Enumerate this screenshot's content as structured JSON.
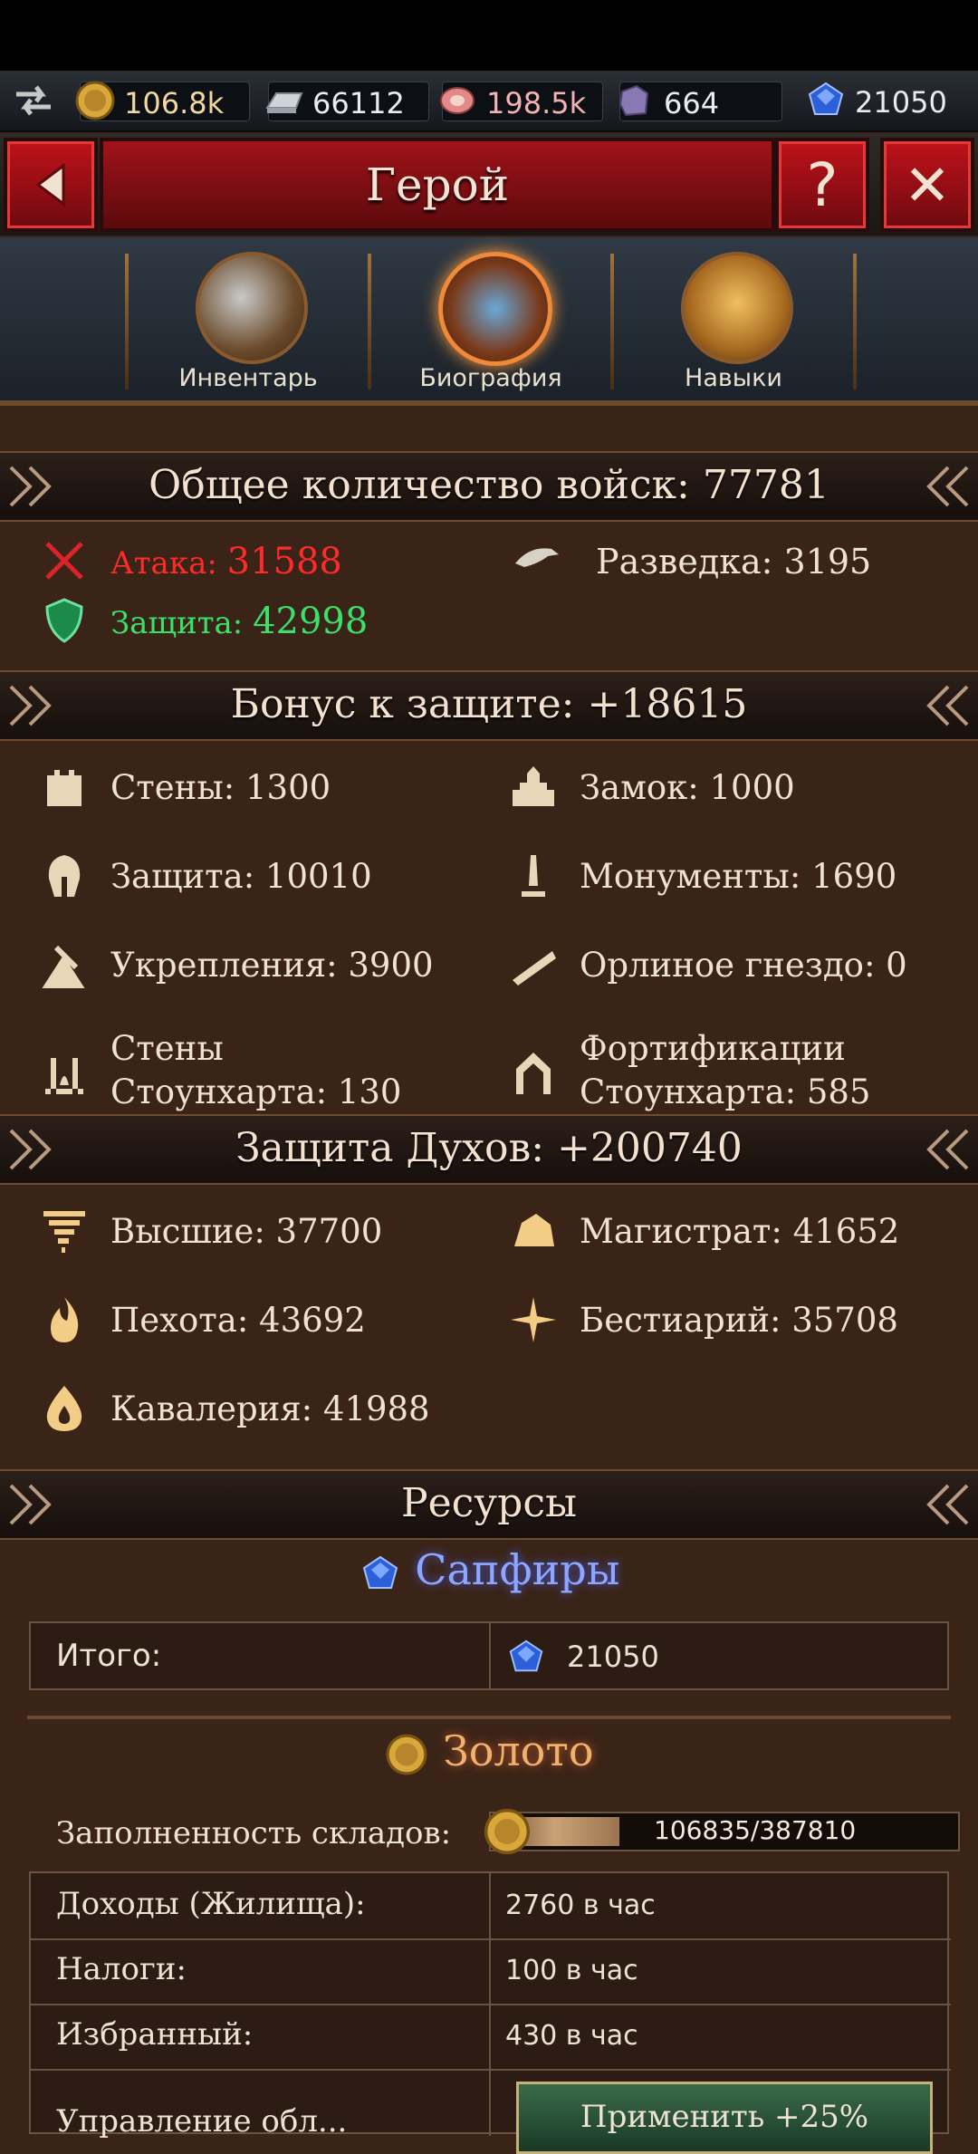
{
  "resources_bar": {
    "gold": "106.8k",
    "iron": "66112",
    "food": "198.5k",
    "stone": "664",
    "sapphires": "21050"
  },
  "header": {
    "title": "Герой",
    "help": "?",
    "close": "✕"
  },
  "tabs": [
    {
      "label": "Инвентарь",
      "icon": "armor-flail-icon"
    },
    {
      "label": "Биография",
      "icon": "books-icon"
    },
    {
      "label": "Навыки",
      "icon": "owl-book-icon"
    }
  ],
  "army": {
    "title": "Общее количество войск: 77781",
    "attack_label": "Атака: ",
    "attack_value": "31588",
    "scouting": "Разведка: 3195",
    "defense_label": "Защита: ",
    "defense_value": "42998"
  },
  "defense_bonus": {
    "title": "Бонус к защите: +18615",
    "items": [
      {
        "text": "Стены: 1300",
        "icon": "wall-icon"
      },
      {
        "text": "Замок: 1000",
        "icon": "castle-icon"
      },
      {
        "text": "Защита: 10010",
        "icon": "helmet-icon"
      },
      {
        "text": "Монументы: 1690",
        "icon": "monument-icon"
      },
      {
        "text": "Укрепления: 3900",
        "icon": "fortification-icon"
      },
      {
        "text": "Орлиное гнездо: 0",
        "icon": "spyglass-icon"
      },
      {
        "text1": "Стены",
        "text2": "Стоунхарта: 130",
        "icon": "stoneheart-walls-icon"
      },
      {
        "text1": "Фортификации",
        "text2": "Стоунхарта: 585",
        "icon": "stoneheart-fort-icon"
      }
    ]
  },
  "spirit_defense": {
    "title": "Защита Духов: +200740",
    "items": [
      {
        "text": "Высшие: 37700",
        "icon": "tornado-icon"
      },
      {
        "text": "Магистрат: 41652",
        "icon": "rock-icon"
      },
      {
        "text": "Пехота: 43692",
        "icon": "flame-icon"
      },
      {
        "text": "Бестиарий: 35708",
        "icon": "sparkle-icon"
      },
      {
        "text": "Кавалерия: 41988",
        "icon": "drop-icon"
      }
    ]
  },
  "resources": {
    "title": "Ресурсы",
    "sapphires_title": "Сапфиры",
    "total_label": "Итого:",
    "total_value": "21050",
    "gold_title": "Золото",
    "storage_label": "Заполненность складов:",
    "storage_value": "106835/387810",
    "storage_fraction": 0.275,
    "rows": [
      {
        "label": "Доходы (Жилища):",
        "value": "2760 в час"
      },
      {
        "label": "Налоги:",
        "value": "100 в час"
      },
      {
        "label": "Избранный:",
        "value": "430 в час"
      }
    ],
    "partial_label": "Управление обл...",
    "apply_button": "Применить +25%"
  },
  "colors": {
    "attack": "#ff2a2a",
    "defense": "#39e06a",
    "sapphire": "#8fa6ff",
    "gold": "#f0b070"
  }
}
